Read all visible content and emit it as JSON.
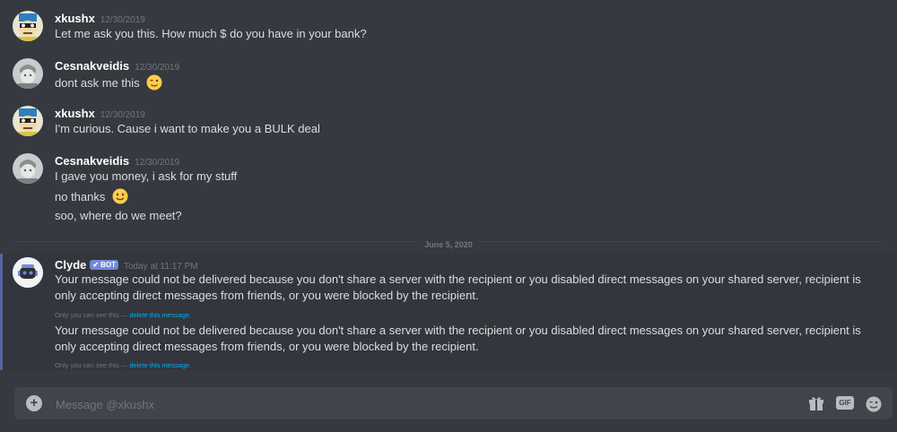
{
  "messages": [
    {
      "author": "xkushx",
      "timestamp": "12/30/2019",
      "avatar": "robot-avatar",
      "lines": [
        "Let me ask you this. How much $ do you have in your bank?"
      ]
    },
    {
      "author": "Cesnakveidis",
      "timestamp": "12/30/2019",
      "avatar": "sketch-avatar",
      "lines": [
        "dont ask me this"
      ],
      "emoji": "winking-face-emoji"
    },
    {
      "author": "xkushx",
      "timestamp": "12/30/2019",
      "avatar": "robot-avatar",
      "lines": [
        "I'm curious. Cause i want to make you a BULK deal"
      ]
    },
    {
      "author": "Cesnakveidis",
      "timestamp": "12/30/2019",
      "avatar": "sketch-avatar",
      "lines": [
        "I gave you money, i ask for my stuff",
        "no thanks",
        "soo, where do we meet?"
      ],
      "emoji": "smiling-face-emoji"
    }
  ],
  "date_divider": "June 5, 2020",
  "bot_message": {
    "author": "Clyde",
    "tag": "BOT",
    "timestamp": "Today at 11:17 PM",
    "text1": "Your message could not be delivered because you don't share a server with the recipient or you disabled direct messages on your shared server, recipient is only accepting direct messages from friends, or you were blocked by the recipient.",
    "text2": "Your message could not be delivered because you don't share a server with the recipient or you disabled direct messages on your shared server, recipient is only accepting direct messages from friends, or you were blocked by the recipient.",
    "ephemeral_note": "Only you can see this —",
    "delete_link": "delete this message."
  },
  "composer": {
    "placeholder": "Message @xkushx",
    "plus_icon": "plus-circle-icon",
    "gift_icon": "gift-icon",
    "gif_label": "GIF",
    "emoji_icon": "emoji-picker-icon"
  },
  "colors": {
    "background": "#36393f",
    "accent": "#7289da",
    "link": "#00b0f4",
    "composer": "#40444b"
  }
}
